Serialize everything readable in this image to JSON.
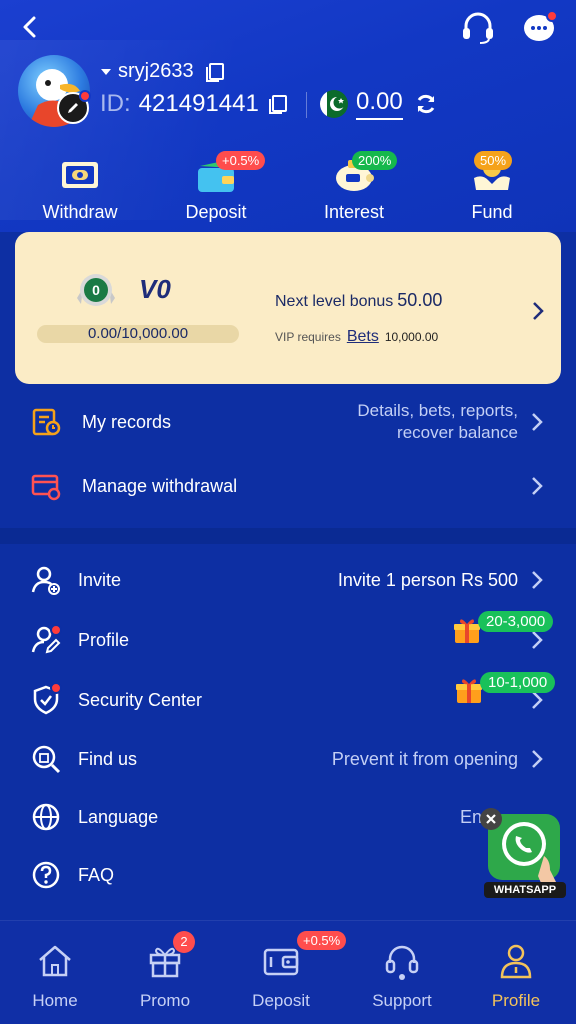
{
  "header": {
    "username": "sryj2633",
    "id_label": "ID:",
    "id_value": "421491441",
    "balance": "0.00"
  },
  "quick_actions": [
    {
      "label": "Withdraw",
      "icon": "withdraw-ticket-icon"
    },
    {
      "label": "Deposit",
      "icon": "wallet-icon",
      "badge": "+0.5%"
    },
    {
      "label": "Interest",
      "icon": "piggy-bank-icon",
      "badge": "200%"
    },
    {
      "label": "Fund",
      "icon": "fund-hands-icon",
      "badge": "50%"
    }
  ],
  "vip": {
    "medal_level": "0",
    "level": "V0",
    "progress_text": "0.00/10,000.00",
    "progress_fraction": 0,
    "next_label": "Next level bonus",
    "next_value": "50.00",
    "req_label": "VIP requires",
    "req_link": "Bets",
    "req_amount": "10,000.00"
  },
  "records": {
    "label": "My records",
    "detail_line1": "Details, bets, reports,",
    "detail_line2": "recover balance"
  },
  "withdrawal": {
    "label": "Manage withdrawal"
  },
  "menu": {
    "invite": {
      "label": "Invite",
      "detail": "Invite 1 person Rs 500"
    },
    "profile": {
      "label": "Profile",
      "tag": "20-3,000"
    },
    "security": {
      "label": "Security Center",
      "tag": "10-1,000"
    },
    "findus": {
      "label": "Find us",
      "detail": "Prevent it from opening"
    },
    "language": {
      "label": "Language",
      "detail": "Eng"
    },
    "faq": {
      "label": "FAQ"
    }
  },
  "whatsapp": {
    "label": "WHATSAPP"
  },
  "bottom_nav": [
    {
      "label": "Home",
      "icon": "home-icon"
    },
    {
      "label": "Promo",
      "icon": "gift-icon",
      "badge": "2"
    },
    {
      "label": "Deposit",
      "icon": "deposit-wallet-icon",
      "badge": "+0.5%"
    },
    {
      "label": "Support",
      "icon": "headset-icon"
    },
    {
      "label": "Profile",
      "icon": "user-icon",
      "active": true
    }
  ],
  "colors": {
    "background": "#0d2fa3",
    "vip_card": "#fbecc6",
    "active_nav": "#f3c35b",
    "badge_red": "#ff4d4d",
    "badge_green": "#16b84c"
  }
}
